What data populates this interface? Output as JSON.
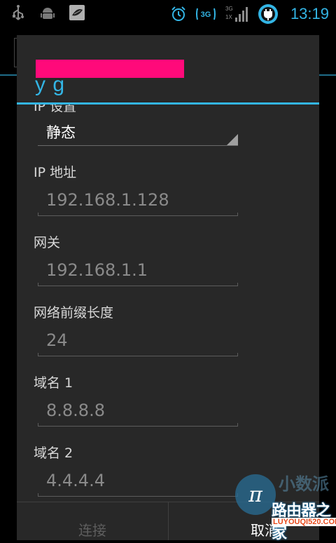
{
  "status_bar": {
    "time": "13:19",
    "network_badge": "3G",
    "signal_label_top": "3G",
    "signal_label_bottom": "1X",
    "left_icons": [
      "usb-icon",
      "android-debug-icon",
      "app-notification-icon"
    ],
    "right_icons": [
      "alarm-icon",
      "sync-3g-icon",
      "signal-icon",
      "battery-charging-icon"
    ],
    "accent_color": "#33b5e5"
  },
  "dialog": {
    "title_partial": "y    g",
    "redaction_color": "#ff0a7a",
    "ip_settings_label": "IP 设置",
    "ip_settings_value": "静态",
    "fields": [
      {
        "label": "IP 地址",
        "value": "192.168.1.128"
      },
      {
        "label": "网关",
        "value": "192.168.1.1"
      },
      {
        "label": "网络前缀长度",
        "value": "24"
      },
      {
        "label": "域名 1",
        "value": "8.8.8.8"
      },
      {
        "label": "域名 2",
        "value": "4.4.4.4"
      }
    ],
    "buttons": {
      "connect": "连接",
      "cancel": "取消"
    }
  },
  "watermark": {
    "top_text": "小数派",
    "main_text": "路由器之家",
    "sub_text": "LUYOUQI520.COM",
    "logo_glyph": "π"
  }
}
